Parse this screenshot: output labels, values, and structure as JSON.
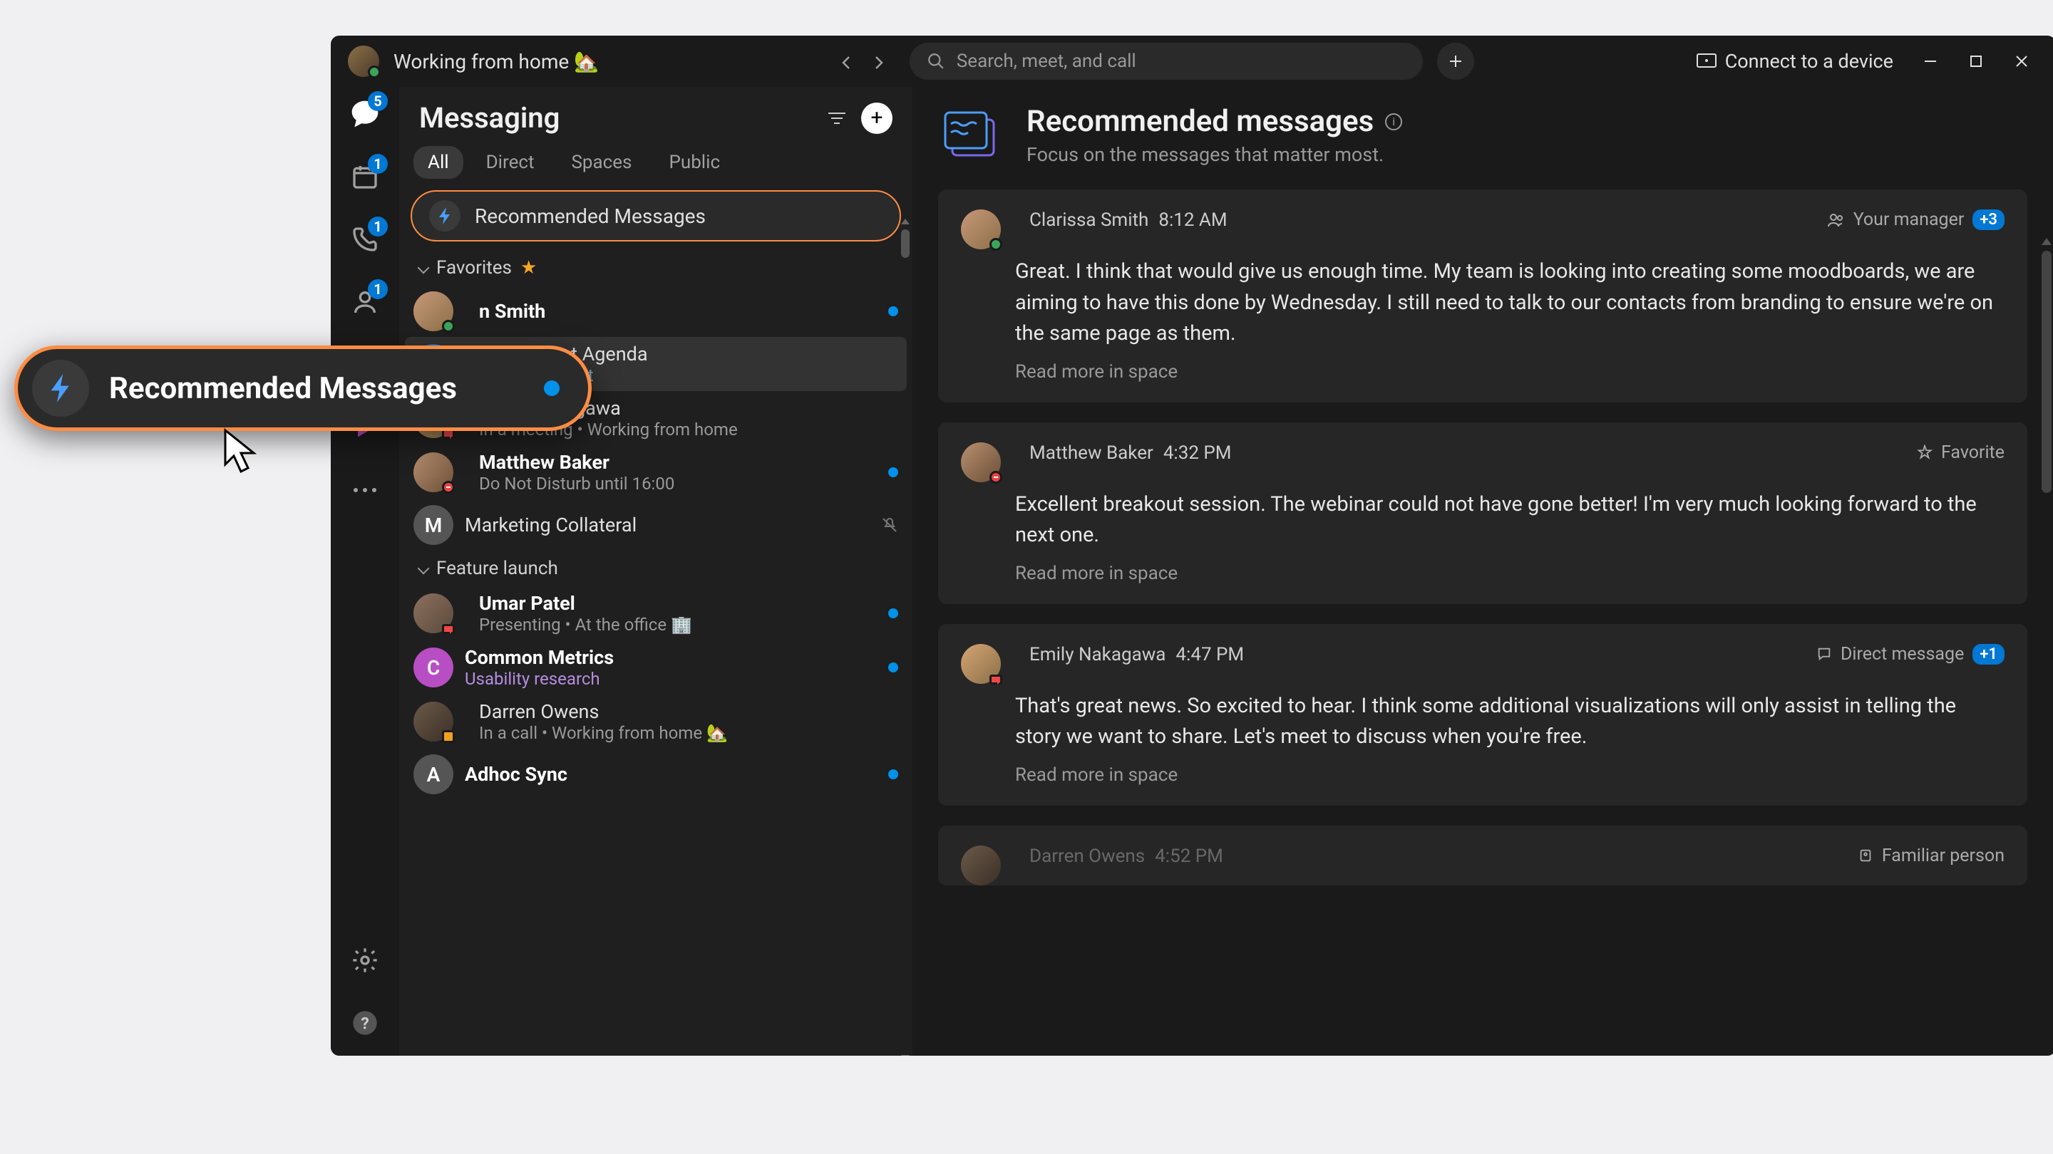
{
  "titlebar": {
    "status": "Working from home 🏡",
    "search_placeholder": "Search, meet, and call",
    "connect_label": "Connect to a device"
  },
  "nav_rail": {
    "items": [
      {
        "name": "chat",
        "badge": "5",
        "active": true
      },
      {
        "name": "calendar",
        "badge": "1"
      },
      {
        "name": "calls",
        "badge": "1"
      },
      {
        "name": "contacts",
        "badge": "1"
      },
      {
        "name": "voicemail"
      },
      {
        "name": "apps"
      }
    ]
  },
  "messaging": {
    "title": "Messaging",
    "tabs": [
      {
        "label": "All",
        "active": true
      },
      {
        "label": "Direct"
      },
      {
        "label": "Spaces"
      },
      {
        "label": "Public"
      }
    ],
    "recommended_label": "Recommended Messages",
    "sections": [
      {
        "label": "Favorites",
        "starred": true,
        "items": [
          {
            "name": "Clarissa Smith",
            "avatar": "photo",
            "presence": "active",
            "bold": true,
            "unread": true,
            "truncated": true,
            "truncated_text": "n Smith"
          },
          {
            "name": "Development Agenda",
            "avatar": "D",
            "avatar_color": "#1976d2",
            "sub": "ENG Deployment",
            "sub_style": "blue",
            "selected": true
          },
          {
            "name": "Emily Nakagawa",
            "avatar": "photo",
            "presence": "camera",
            "sub": "In a meeting  •  Working from home"
          },
          {
            "name": "Matthew Baker",
            "avatar": "photo",
            "presence": "dnd",
            "sub": "Do Not Disturb until 16:00",
            "bold": true,
            "unread": true
          },
          {
            "name": "Marketing Collateral",
            "avatar": "M",
            "avatar_color": "#555",
            "muted": true
          }
        ]
      },
      {
        "label": "Feature launch",
        "items": [
          {
            "name": "Umar Patel",
            "avatar": "photo",
            "presence": "camera",
            "sub": "Presenting  •  At the office 🏢",
            "bold": true,
            "unread": true
          },
          {
            "name": "Common Metrics",
            "avatar": "C",
            "avatar_color": "#b84ec4",
            "sub": "Usability research",
            "sub_style": "purple",
            "bold": true,
            "unread": true
          },
          {
            "name": "Darren Owens",
            "avatar": "photo",
            "presence": "phone",
            "sub": "In a call  •  Working from home 🏡"
          },
          {
            "name": "Adhoc Sync",
            "avatar": "A",
            "avatar_color": "#555",
            "bold": true,
            "unread": true
          }
        ]
      }
    ]
  },
  "content": {
    "title": "Recommended messages",
    "subtitle": "Focus on the messages that matter most.",
    "read_more": "Read more in space",
    "cards": [
      {
        "author": "Clarissa Smith",
        "time": "8:12 AM",
        "presence": "active",
        "tag": "Your manager",
        "tag_icon": "people",
        "tag_badge": "+3",
        "body": "Great. I think that would give us enough time. My team is looking into creating some moodboards, we are aiming to have this done by Wednesday. I still need to talk to our contacts from branding to ensure we're on the same page as them."
      },
      {
        "author": "Matthew Baker",
        "time": "4:32 PM",
        "presence": "dnd",
        "tag": "Favorite",
        "tag_icon": "star",
        "body": "Excellent breakout session. The webinar could not have gone better! I'm very much looking forward to the next one."
      },
      {
        "author": "Emily Nakagawa",
        "time": "4:47 PM",
        "presence": "camera",
        "tag": "Direct message",
        "tag_icon": "chat",
        "tag_badge": "+1",
        "body": "That's great news. So excited to hear. I think some additional visualizations will only assist in telling the story we want to share. Let's meet to discuss when you're free."
      },
      {
        "author": "Darren Owens",
        "time": "4:52 PM",
        "presence": "phone",
        "tag": "Familiar person",
        "tag_icon": "person",
        "body": ""
      }
    ]
  },
  "callout": {
    "label": "Recommended Messages"
  }
}
